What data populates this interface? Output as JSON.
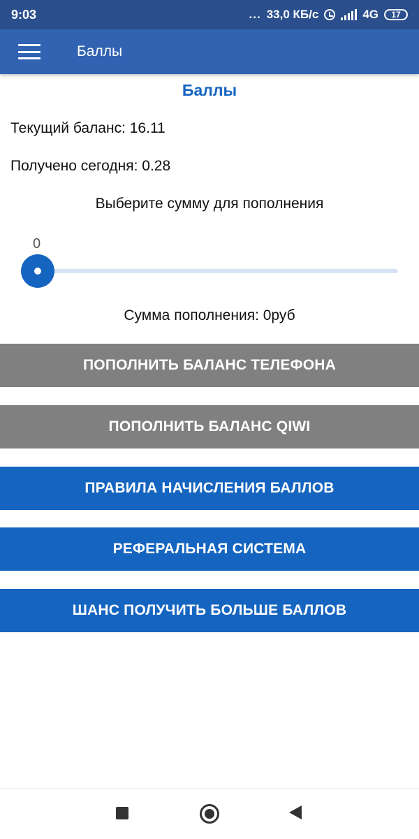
{
  "status_bar": {
    "time": "9:03",
    "dots": "...",
    "network_speed": "33,0 КБ/с",
    "network_type": "4G",
    "network_sub": "ıl",
    "battery": "17"
  },
  "app_bar": {
    "title": "Баллы"
  },
  "content": {
    "heading": "Баллы",
    "current_balance": "Текущий баланс: 16.11",
    "received_today": "Получено сегодня: 0.28",
    "prompt": "Выберите сумму для пополнения",
    "slider_value": "0",
    "sum_text": "Сумма пополнения: 0руб"
  },
  "buttons": {
    "top_up_phone": "ПОПОЛНИТЬ БАЛАНС ТЕЛЕФОНА",
    "top_up_qiwi": "ПОПОЛНИТЬ БАЛАНС QIWI",
    "rules": "ПРАВИЛА НАЧИСЛЕНИЯ БАЛЛОВ",
    "referral": "РЕФЕРАЛЬНАЯ СИСТЕМА",
    "chance": "ШАНС ПОЛУЧИТЬ БОЛЬШЕ БАЛЛОВ"
  },
  "colors": {
    "status_bar": "#2a4f8c",
    "app_bar": "#3163b2",
    "accent_blue": "#1565c0",
    "disabled_gray": "#808080"
  },
  "icons": {
    "menu": "menu-icon",
    "alarm": "alarm-icon",
    "signal": "signal-icon",
    "battery": "battery-icon",
    "nav_recents": "square-icon",
    "nav_home": "circle-icon",
    "nav_back": "back-triangle-icon"
  }
}
